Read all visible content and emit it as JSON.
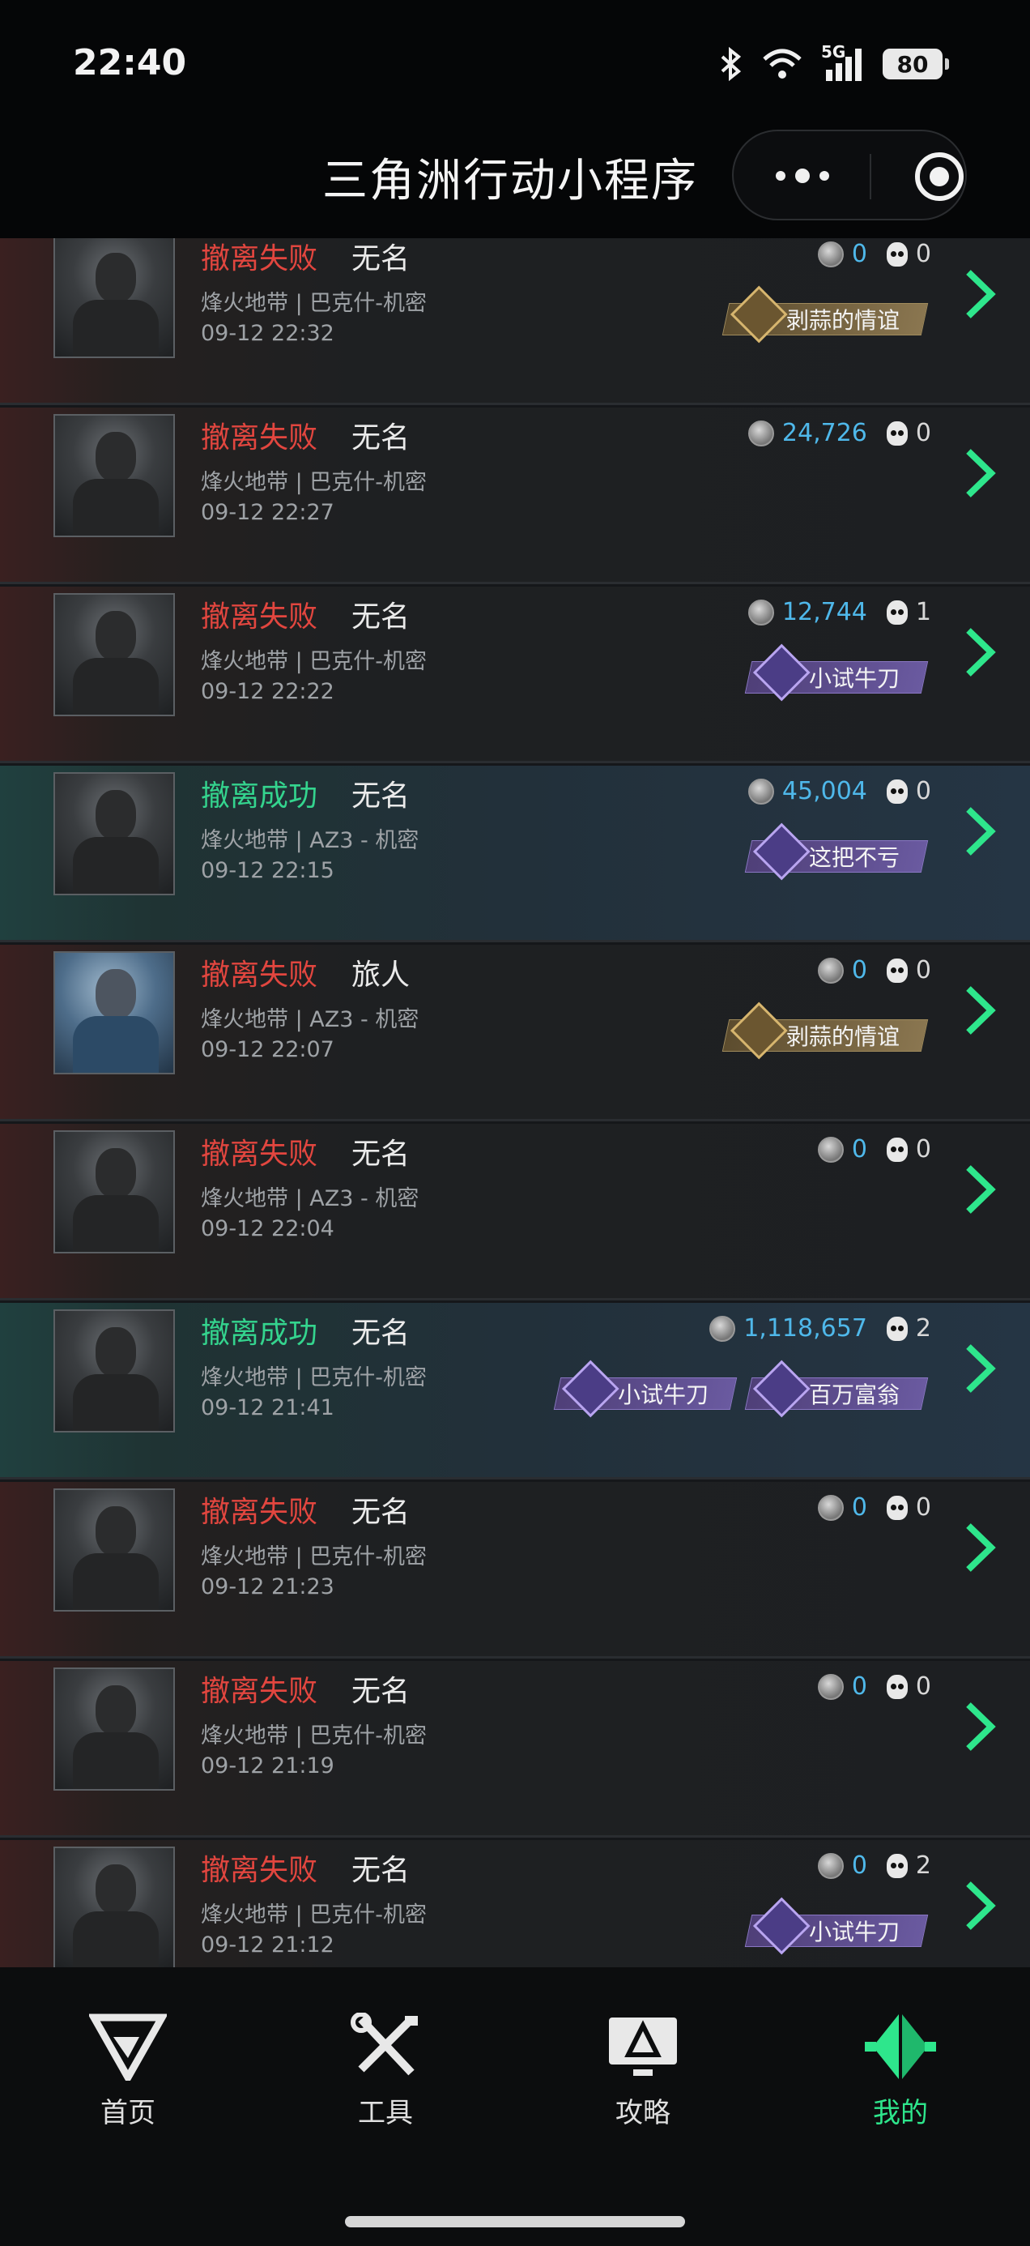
{
  "status_bar": {
    "time": "22:40",
    "battery": "80",
    "network": "5G"
  },
  "title_bar": {
    "title": "三角洲行动小程序",
    "more_icon": "more-dots-icon",
    "close_icon": "target-close-icon"
  },
  "records": [
    {
      "outcome": "撤离失败",
      "outcome_type": "fail",
      "name": "无名",
      "map": "烽火地带 | 巴克什-机密",
      "time": "09-12 22:32",
      "coins": "0",
      "kills": "0",
      "avatar": "dark",
      "badges": [
        {
          "label": "剥蒜的情谊",
          "style": "gold"
        }
      ]
    },
    {
      "outcome": "撤离失败",
      "outcome_type": "fail",
      "name": "无名",
      "map": "烽火地带 | 巴克什-机密",
      "time": "09-12 22:27",
      "coins": "24,726",
      "kills": "0",
      "avatar": "dark",
      "badges": []
    },
    {
      "outcome": "撤离失败",
      "outcome_type": "fail",
      "name": "无名",
      "map": "烽火地带 | 巴克什-机密",
      "time": "09-12 22:22",
      "coins": "12,744",
      "kills": "1",
      "avatar": "dark",
      "badges": [
        {
          "label": "小试牛刀",
          "style": "purple"
        }
      ]
    },
    {
      "outcome": "撤离成功",
      "outcome_type": "success",
      "name": "无名",
      "map": "烽火地带 | AZ3 - 机密",
      "time": "09-12 22:15",
      "coins": "45,004",
      "kills": "0",
      "avatar": "dark",
      "badges": [
        {
          "label": "这把不亏",
          "style": "purple"
        }
      ]
    },
    {
      "outcome": "撤离失败",
      "outcome_type": "fail",
      "name": "旅人",
      "map": "烽火地带 | AZ3 - 机密",
      "time": "09-12 22:07",
      "coins": "0",
      "kills": "0",
      "avatar": "alt",
      "badges": [
        {
          "label": "剥蒜的情谊",
          "style": "gold"
        }
      ]
    },
    {
      "outcome": "撤离失败",
      "outcome_type": "fail",
      "name": "无名",
      "map": "烽火地带 | AZ3 - 机密",
      "time": "09-12 22:04",
      "coins": "0",
      "kills": "0",
      "avatar": "dark",
      "badges": []
    },
    {
      "outcome": "撤离成功",
      "outcome_type": "success",
      "name": "无名",
      "map": "烽火地带 | 巴克什-机密",
      "time": "09-12 21:41",
      "coins": "1,118,657",
      "kills": "2",
      "avatar": "dark",
      "badges": [
        {
          "label": "小试牛刀",
          "style": "purple"
        },
        {
          "label": "百万富翁",
          "style": "purple"
        }
      ]
    },
    {
      "outcome": "撤离失败",
      "outcome_type": "fail",
      "name": "无名",
      "map": "烽火地带 | 巴克什-机密",
      "time": "09-12 21:23",
      "coins": "0",
      "kills": "0",
      "avatar": "dark",
      "badges": []
    },
    {
      "outcome": "撤离失败",
      "outcome_type": "fail",
      "name": "无名",
      "map": "烽火地带 | 巴克什-机密",
      "time": "09-12 21:19",
      "coins": "0",
      "kills": "0",
      "avatar": "dark",
      "badges": []
    },
    {
      "outcome": "撤离失败",
      "outcome_type": "fail",
      "name": "无名",
      "map": "烽火地带 | 巴克什-机密",
      "time": "09-12 21:12",
      "coins": "0",
      "kills": "2",
      "avatar": "dark",
      "badges": [
        {
          "label": "小试牛刀",
          "style": "purple"
        }
      ]
    }
  ],
  "bottom_nav": {
    "items": [
      {
        "label": "首页",
        "icon": "home-g-icon",
        "active": false
      },
      {
        "label": "工具",
        "icon": "tools-icon",
        "active": false
      },
      {
        "label": "攻略",
        "icon": "guide-monitor-icon",
        "active": false
      },
      {
        "label": "我的",
        "icon": "profile-logo-icon",
        "active": true
      }
    ]
  },
  "colors": {
    "fail": "#e2463f",
    "success": "#34d48e",
    "coin": "#4fb8ea",
    "accent": "#2ee68c"
  }
}
